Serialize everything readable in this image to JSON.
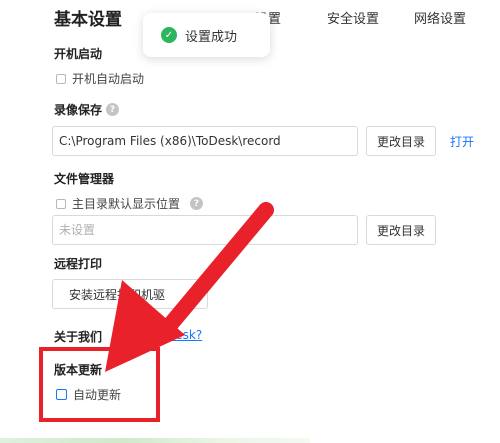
{
  "header": {
    "title": "基本设置",
    "tabs": [
      "",
      "",
      "安全设置",
      "网络设置"
    ],
    "tab_fragment": "设置"
  },
  "toast": {
    "text": "设置成功",
    "icon": "check-circle-icon"
  },
  "startup": {
    "title": "开机启动",
    "option_label": "开机自动启动"
  },
  "recording": {
    "title": "录像保存",
    "path_value": "C:\\Program Files (x86)\\ToDesk\\record",
    "change_button": "更改目录",
    "open_link": "打开"
  },
  "file_manager": {
    "title": "文件管理器",
    "option_label": "主目录默认显示位置",
    "path_placeholder": "未设置",
    "change_button": "更改目录"
  },
  "remote_print": {
    "title": "远程打印",
    "install_button": "安装远程打印机驱"
  },
  "about": {
    "title": "关于我们",
    "link_fragment": "Desk?"
  },
  "version_update": {
    "title": "版本更新",
    "option_label": "自动更新"
  },
  "annotation": {
    "color": "#e8212b",
    "type": "arrow-and-box"
  }
}
